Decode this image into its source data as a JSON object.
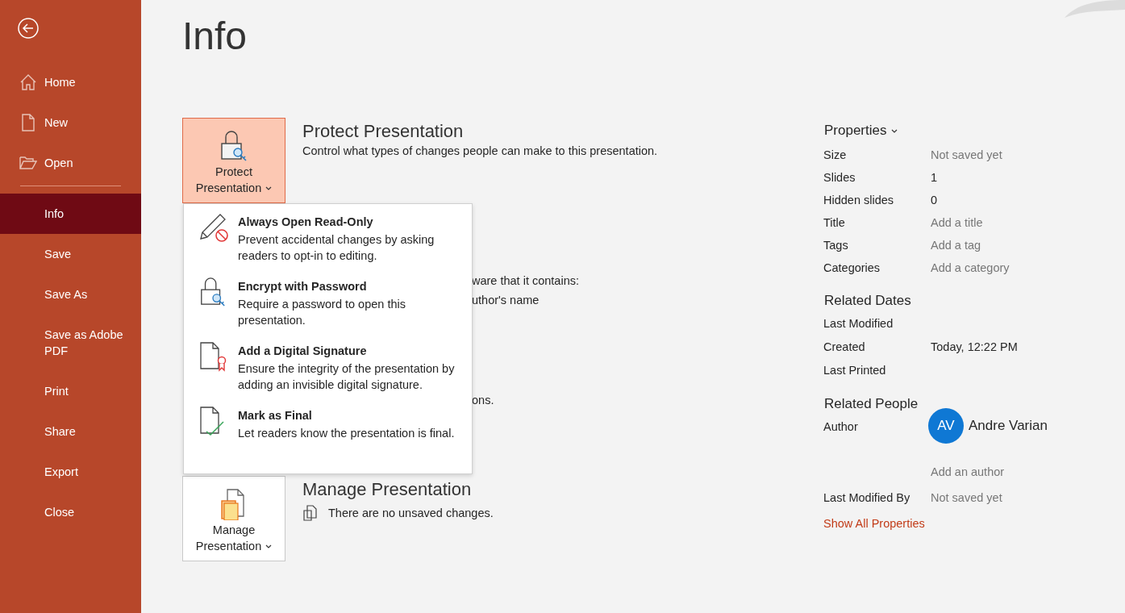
{
  "sidebar": {
    "top_items": [
      {
        "label": "Home",
        "selected": false
      },
      {
        "label": "New",
        "selected": false
      },
      {
        "label": "Open",
        "selected": false
      }
    ],
    "items": [
      {
        "label": "Info",
        "selected": true
      },
      {
        "label": "Save",
        "selected": false
      },
      {
        "label": "Save As",
        "selected": false
      },
      {
        "label": "Save as Adobe PDF",
        "selected": false
      },
      {
        "label": "Print",
        "selected": false
      },
      {
        "label": "Share",
        "selected": false
      },
      {
        "label": "Export",
        "selected": false
      },
      {
        "label": "Close",
        "selected": false
      }
    ]
  },
  "page_title": "Info",
  "protect": {
    "button_label": "Protect Presentation",
    "heading": "Protect Presentation",
    "description": "Control what types of changes people can make to this presentation.",
    "menu": [
      {
        "title": "Always Open Read-Only",
        "description": "Prevent accidental changes by asking readers to opt-in to editing."
      },
      {
        "title": "Encrypt with Password",
        "description": "Require a password to open this presentation."
      },
      {
        "title": "Add a Digital Signature",
        "description": "Ensure the integrity of the presentation by adding an invisible digital signature."
      },
      {
        "title": "Mark as Final",
        "description": "Let readers know the presentation is final."
      }
    ]
  },
  "inspect_fragments": [
    "ware that it contains:",
    "uthor's name",
    "ons."
  ],
  "manage": {
    "button_label": "Manage Presentation",
    "heading": "Manage Presentation",
    "status": "There are no unsaved changes."
  },
  "properties": {
    "heading": "Properties",
    "rows": [
      {
        "label": "Size",
        "value": "Not saved yet",
        "muted": true
      },
      {
        "label": "Slides",
        "value": "1",
        "muted": false
      },
      {
        "label": "Hidden slides",
        "value": "0",
        "muted": false
      },
      {
        "label": "Title",
        "value": "Add a title",
        "muted": true
      },
      {
        "label": "Tags",
        "value": "Add a tag",
        "muted": true
      },
      {
        "label": "Categories",
        "value": "Add a category",
        "muted": true
      }
    ]
  },
  "related_dates": {
    "heading": "Related Dates",
    "rows": [
      {
        "label": "Last Modified"
      },
      {
        "label": "Created",
        "value": "Today, 12:22 PM"
      },
      {
        "label": "Last Printed"
      }
    ]
  },
  "related_people": {
    "heading": "Related People",
    "author_label": "Author",
    "author_initials": "AV",
    "author_name": "Andre Varian",
    "add_author": "Add an author",
    "last_modified_by_label": "Last Modified By",
    "last_modified_by": "Not saved yet"
  },
  "show_all_link": "Show All Properties"
}
